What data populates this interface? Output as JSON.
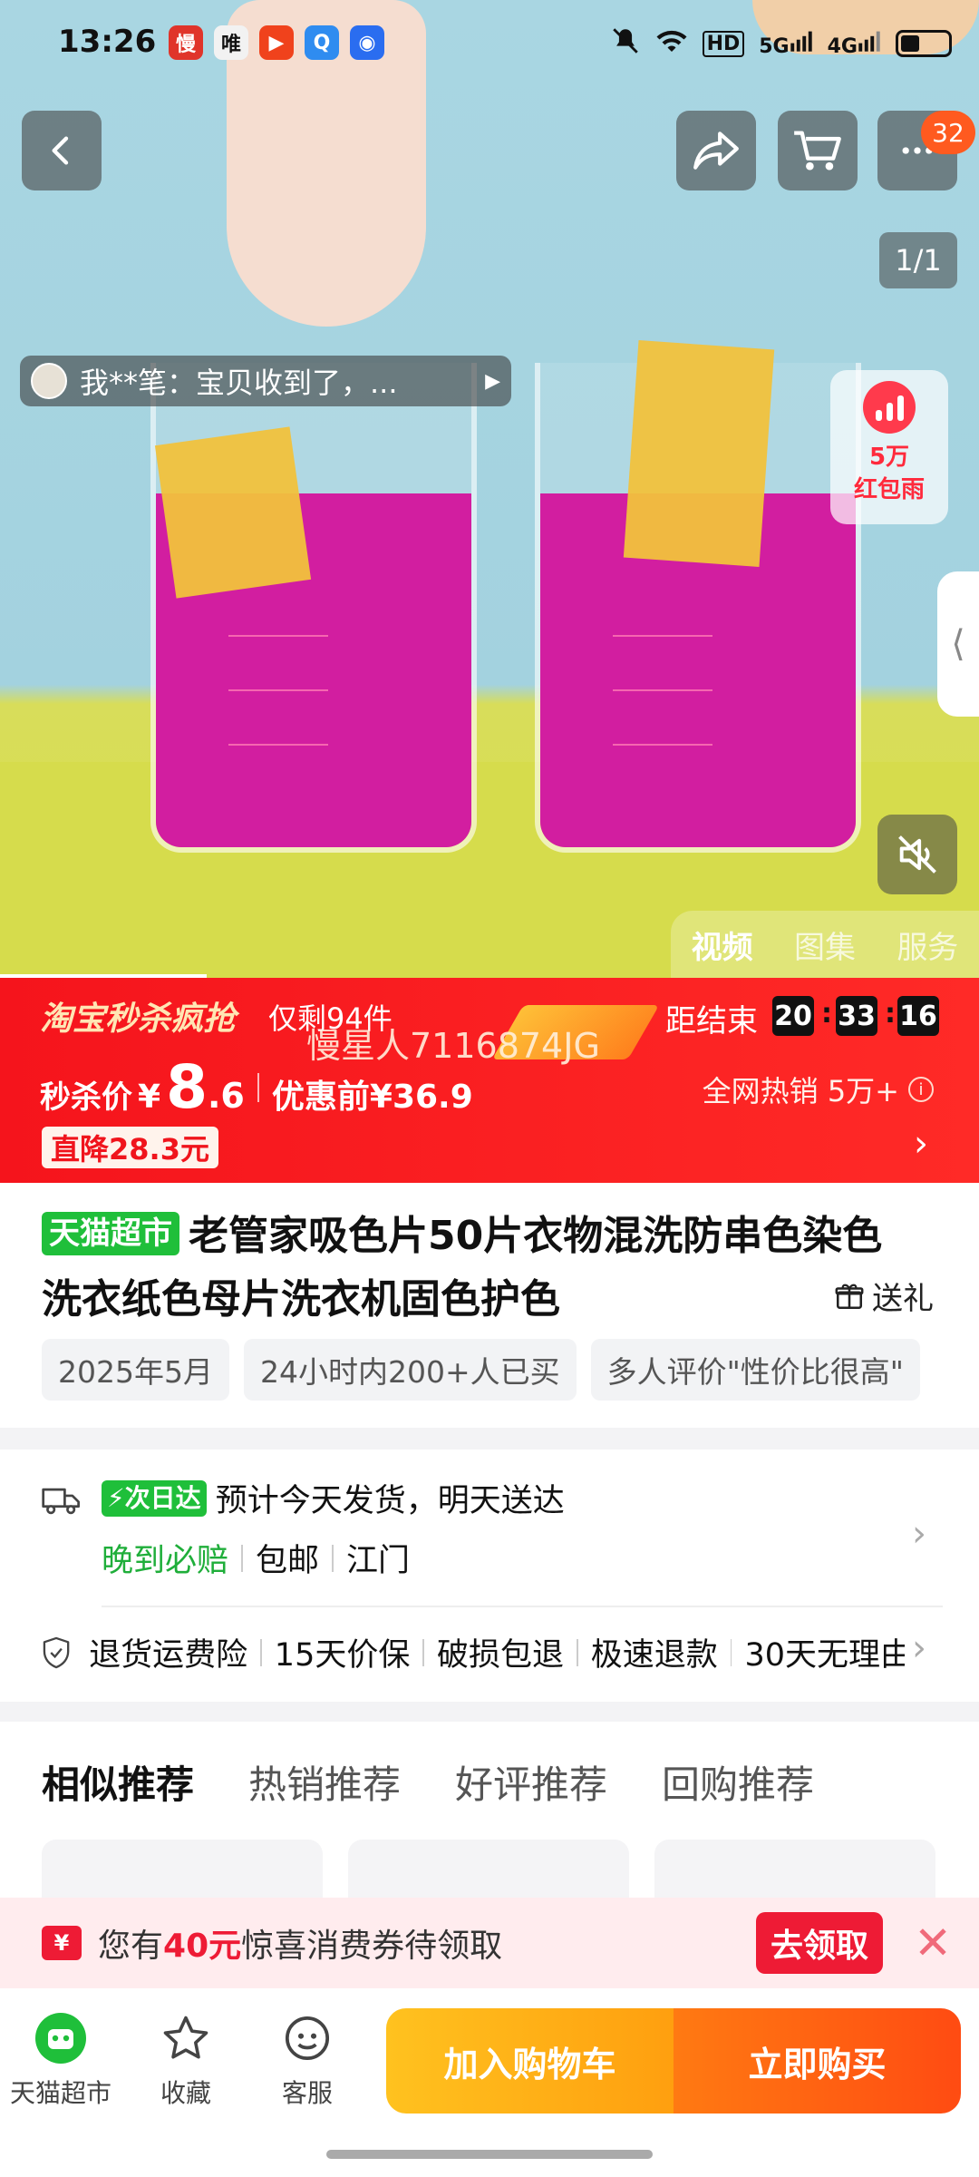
{
  "status_bar": {
    "time": "13:26",
    "app_icons": [
      {
        "name": "slow-app-icon",
        "glyph": "慢",
        "color": "#e0342a"
      },
      {
        "name": "vip-app-icon",
        "glyph": "唯",
        "color": "#f2f2f2"
      },
      {
        "name": "video-app-icon",
        "glyph": "▶",
        "color": "#f0421c"
      },
      {
        "name": "browser-app-icon",
        "glyph": "Q",
        "color": "#2f8cf0"
      },
      {
        "name": "camera-app-icon",
        "glyph": "◉",
        "color": "#2a6df0"
      }
    ],
    "hd_label": "HD",
    "net_5g": "5G",
    "net_4g": "4G"
  },
  "top_bar": {
    "cart_badge": "32"
  },
  "media": {
    "page_indicator": "1/1",
    "review_text": "我**笔：宝贝收到了，...",
    "red_packet_amount": "5万",
    "red_packet_label": "红包雨",
    "side_tab_glyph": "⟨",
    "tabs": [
      "视频",
      "图集",
      "服务"
    ],
    "active_tab": 0
  },
  "flash_sale": {
    "brand": "淘宝秒杀疯抢",
    "stock_left": "仅剩94件",
    "watermark": "慢星人7116874JG",
    "end_label": "距结束",
    "countdown": [
      "20",
      "33",
      "16"
    ],
    "price_label": "秒杀价",
    "currency": "¥",
    "price_int": "8",
    "price_dec": ".6",
    "original_price": "优惠前¥36.9",
    "hot_sales": "全网热销 5万+",
    "discount": "直降28.3元"
  },
  "product": {
    "store_tag": "天猫超市",
    "title": "老管家吸色片50片衣物混洗防串色染色洗衣纸色母片洗衣机固色护色",
    "gift_label": "送礼",
    "chips": [
      "2025年5月",
      "24小时内200+人已买",
      "多人评价\"性价比很高\""
    ]
  },
  "delivery": {
    "next_day_tag": "次日达",
    "estimate": "预计今天发货，明天送达",
    "late_comp": "晚到必赔",
    "free_ship": "包邮",
    "origin": "江门",
    "services": [
      "退货运费险",
      "15天价保",
      "破损包退",
      "极速退款",
      "30天无理由"
    ]
  },
  "recommend": {
    "tabs": [
      "相似推荐",
      "热销推荐",
      "好评推荐",
      "回购推荐"
    ],
    "active_tab": 0
  },
  "coupon": {
    "prefix": "您有",
    "amount": "40元",
    "suffix": "惊喜消费券待领取",
    "button": "去领取"
  },
  "bottom_bar": {
    "store": "天猫超市",
    "favorite": "收藏",
    "service": "客服",
    "add_to_cart": "加入购物车",
    "buy_now": "立即购买"
  },
  "colors": {
    "sale_red": "#f5141c",
    "tmall_green": "#1fbf3a",
    "cta_yellow": "#ffc21f",
    "cta_orange": "#ff4b12",
    "liquid_magenta": "#d21ea0"
  }
}
